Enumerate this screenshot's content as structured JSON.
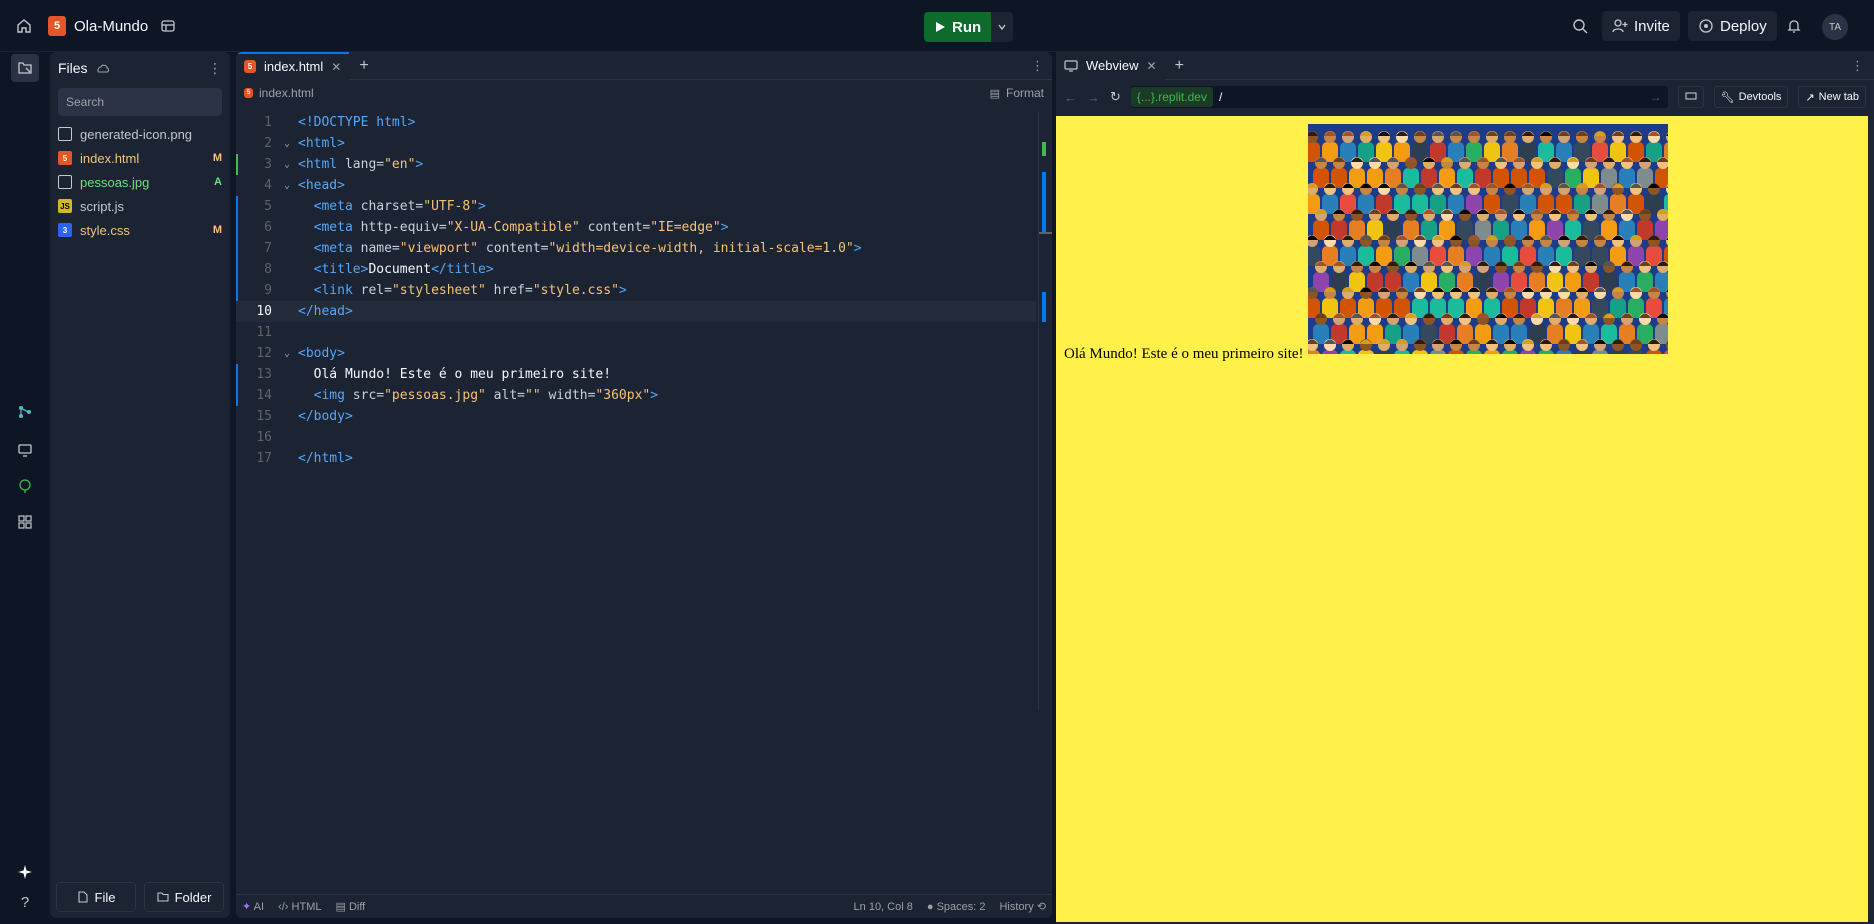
{
  "topbar": {
    "repl_name": "Ola-Mundo",
    "run_label": "Run",
    "invite_label": "Invite",
    "deploy_label": "Deploy",
    "avatar_initials": "TA"
  },
  "files": {
    "title": "Files",
    "search_placeholder": "Search",
    "items": [
      {
        "name": "generated-icon.png",
        "badge": "",
        "color": "#c2c8cc"
      },
      {
        "name": "index.html",
        "badge": "M",
        "color": "#f5c27a"
      },
      {
        "name": "pessoas.jpg",
        "badge": "A",
        "color": "#6ee07a"
      },
      {
        "name": "script.js",
        "badge": "",
        "color": "#c2c8cc"
      },
      {
        "name": "style.css",
        "badge": "M",
        "color": "#f5c27a"
      }
    ],
    "new_file_label": "File",
    "new_folder_label": "Folder"
  },
  "editor": {
    "tab_label": "index.html",
    "breadcrumb": "index.html",
    "format_label": "Format",
    "status": {
      "ai": "AI",
      "lang": "HTML",
      "diff": "Diff",
      "position": "Ln 10, Col 8",
      "spaces": "Spaces: 2",
      "history": "History"
    }
  },
  "webview": {
    "tab_label": "Webview",
    "domain": "{...}.replit.dev",
    "path": "/",
    "devtools_label": "Devtools",
    "newtab_label": "New tab",
    "page_text": "Olá Mundo! Este é o meu primeiro site!"
  }
}
